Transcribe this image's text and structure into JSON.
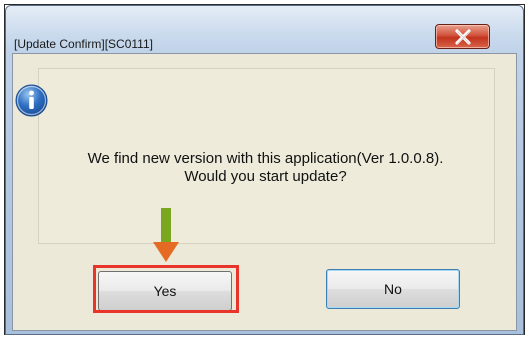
{
  "dialog": {
    "title": "[Update Confirm][SC0111]",
    "message_line1": "We find new version with this application(Ver 1.0.0.8).",
    "message_line2": "Would you start update?",
    "yes_label": "Yes",
    "no_label": "No"
  },
  "icons": {
    "close": "close-icon",
    "info": "info-icon",
    "annotation_arrow": "down-arrow-icon"
  },
  "colors": {
    "highlight": "#e8342a",
    "arrow": "#7ba61f",
    "close_button": "#c2331d",
    "dialog_background": "#ece9d8"
  }
}
